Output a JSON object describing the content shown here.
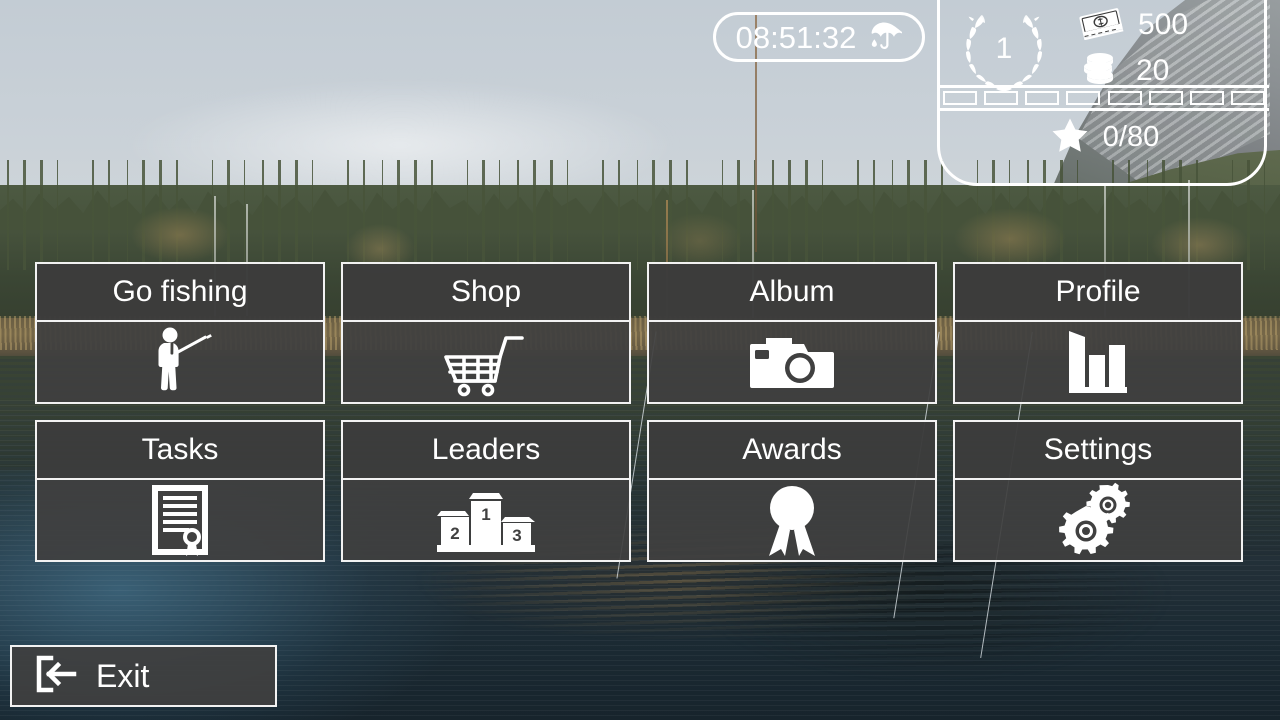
{
  "hud": {
    "clock": {
      "time": "08:51:32",
      "weather_icon": "umbrella-rain-icon"
    },
    "level": {
      "value": "1",
      "icon": "laurel-wreath-icon"
    },
    "money": {
      "icon": "banknotes-icon",
      "value": "500"
    },
    "coins": {
      "icon": "coin-stack-icon",
      "value": "20"
    },
    "experience": {
      "icon": "star-icon",
      "value": "0/80",
      "segments_total": 8,
      "segments_filled": 0
    }
  },
  "menu": {
    "items": [
      {
        "label": "Go fishing",
        "icon": "angler-icon"
      },
      {
        "label": "Shop",
        "icon": "shopping-cart-icon"
      },
      {
        "label": "Album",
        "icon": "camera-icon"
      },
      {
        "label": "Profile",
        "icon": "bar-chart-icon"
      },
      {
        "label": "Tasks",
        "icon": "certificate-icon"
      },
      {
        "label": "Leaders",
        "icon": "podium-icon"
      },
      {
        "label": "Awards",
        "icon": "rosette-icon"
      },
      {
        "label": "Settings",
        "icon": "gears-icon"
      }
    ]
  },
  "exit": {
    "label": "Exit",
    "icon": "logout-icon"
  },
  "colors": {
    "panel_bg": "#404040",
    "panel_border": "#f2f2f2",
    "text": "#ffffff"
  },
  "leaders_icon_numbers": {
    "first": "1",
    "second": "2",
    "third": "3"
  }
}
